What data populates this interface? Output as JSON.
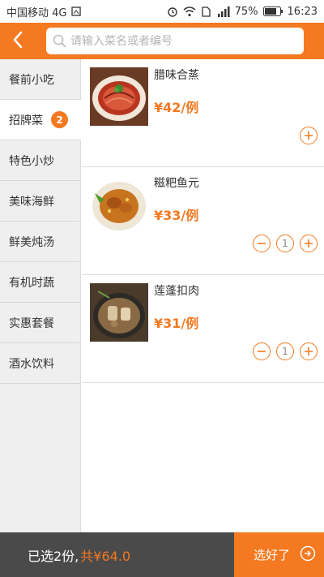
{
  "status_bar": {
    "carrier": "中国移动 4G",
    "battery": "75%",
    "time": "16:23"
  },
  "header": {
    "search_placeholder": "请输入菜名或者编号"
  },
  "sidebar": {
    "items": [
      {
        "label": "餐前小吃"
      },
      {
        "label": "招牌菜",
        "badge": "2"
      },
      {
        "label": "特色小炒"
      },
      {
        "label": "美味海鲜"
      },
      {
        "label": "鲜美炖汤"
      },
      {
        "label": "有机时蔬"
      },
      {
        "label": "实惠套餐"
      },
      {
        "label": "酒水饮料"
      }
    ],
    "active_index": 1
  },
  "dishes": [
    {
      "name": "腊味合蒸",
      "price": "¥42/例",
      "quantity": null
    },
    {
      "name": "糍粑鱼元",
      "price": "¥33/例",
      "quantity": "1"
    },
    {
      "name": "莲蓬扣肉",
      "price": "¥31/例",
      "quantity": "1"
    }
  ],
  "bottom_bar": {
    "selected_text": "已选2份,",
    "total_text": "共¥64.0",
    "confirm_label": "选好了"
  },
  "colors": {
    "accent": "#f47920",
    "bottom_dark": "#4a4a4a"
  }
}
